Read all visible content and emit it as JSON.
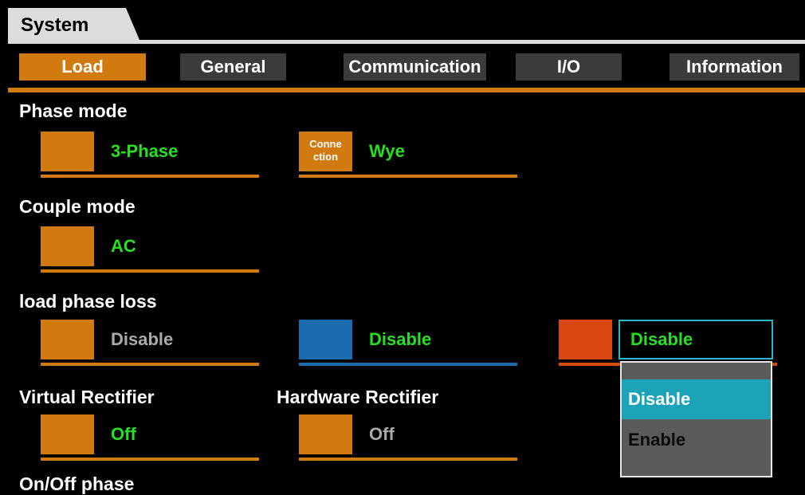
{
  "window": {
    "title": "System"
  },
  "tabs": [
    {
      "label": "Load",
      "active": true
    },
    {
      "label": "General",
      "active": false
    },
    {
      "label": "Communication",
      "active": false
    },
    {
      "label": "I/O",
      "active": false
    },
    {
      "label": "Information",
      "active": false
    }
  ],
  "phase_mode": {
    "label": "Phase mode",
    "value": "3-Phase",
    "connection_label": "Conne ction",
    "connection_value": "Wye"
  },
  "couple_mode": {
    "label": "Couple mode",
    "value": "AC"
  },
  "load_phase_loss": {
    "label": "load phase loss",
    "phase1_value": "Disable",
    "phase2_value": "Disable",
    "phase3_value": "Disable"
  },
  "virtual_rectifier": {
    "label": "Virtual Rectifier",
    "value": "Off"
  },
  "hardware_rectifier": {
    "label": "Hardware Rectifier",
    "value": "Off"
  },
  "on_off_phase": {
    "label": "On/Off phase"
  },
  "dropdown": {
    "options": [
      "Disable",
      "Enable"
    ],
    "selected": "Disable"
  },
  "colors": {
    "accent_orange": "#d07a10",
    "phase_blue": "#1a6cae",
    "phase_red": "#d7470f",
    "value_green": "#27e024",
    "focus_cyan": "#28b8c8"
  }
}
